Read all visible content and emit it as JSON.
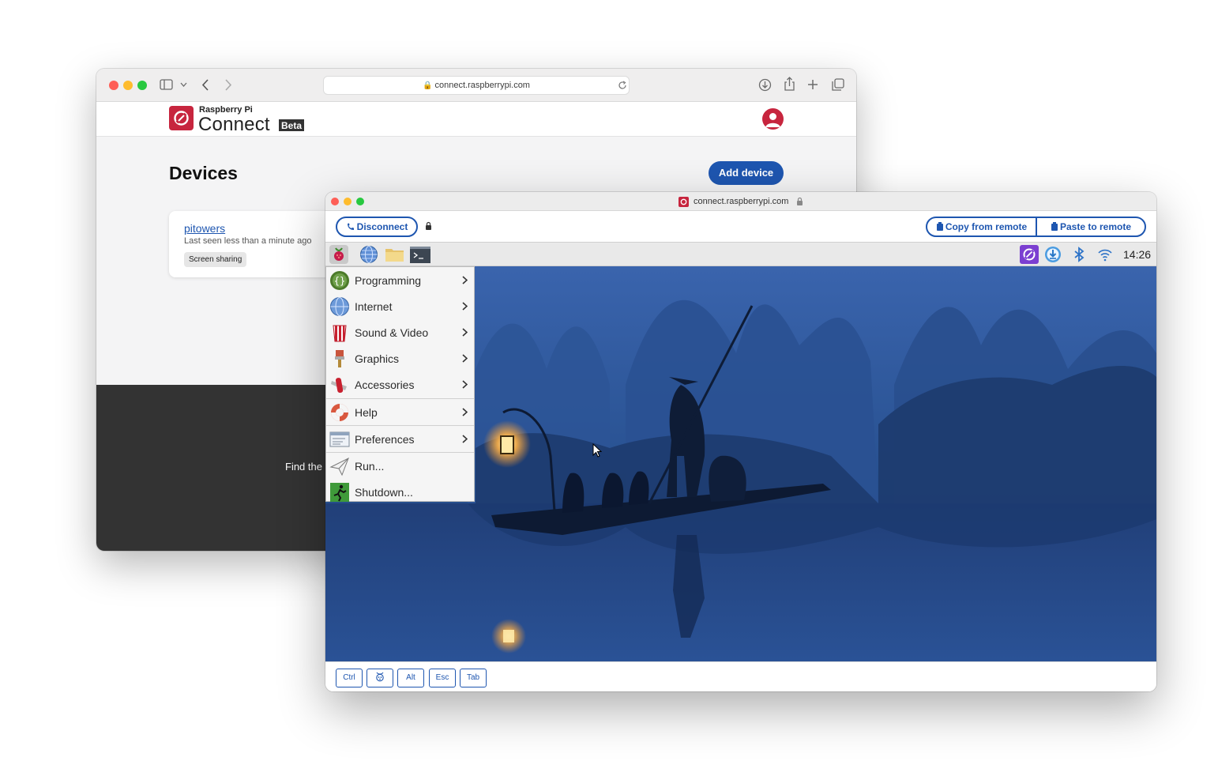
{
  "back_window": {
    "url": "connect.raspberrypi.com",
    "brand_small": "Raspberry Pi",
    "brand_large": "Connect",
    "brand_badge": "Beta",
    "page_title": "Devices",
    "add_device_label": "Add device",
    "device": {
      "name": "pitowers",
      "last_seen": "Last seen less than a minute ago",
      "badge": "Screen sharing"
    },
    "footer_text": "Find the"
  },
  "front_window": {
    "url": "connect.raspberrypi.com",
    "disconnect_label": "Disconnect",
    "copy_label": "Copy from remote",
    "paste_label": "Paste to remote",
    "clock": "14:26",
    "menu": [
      {
        "label": "Programming",
        "icon": "programming-icon"
      },
      {
        "label": "Internet",
        "icon": "internet-icon"
      },
      {
        "label": "Sound & Video",
        "icon": "sound-video-icon"
      },
      {
        "label": "Graphics",
        "icon": "graphics-icon"
      },
      {
        "label": "Accessories",
        "icon": "accessories-icon"
      },
      {
        "label": "Help",
        "icon": "help-icon"
      },
      {
        "label": "Preferences",
        "icon": "preferences-icon"
      },
      {
        "label": "Run...",
        "icon": "run-icon"
      },
      {
        "label": "Shutdown...",
        "icon": "shutdown-icon"
      }
    ],
    "keys": [
      "Ctrl",
      "",
      "Alt",
      "Esc",
      "Tab"
    ]
  },
  "colors": {
    "accent": "#1e56b0",
    "brand": "#c7253e",
    "footer": "#333333"
  }
}
